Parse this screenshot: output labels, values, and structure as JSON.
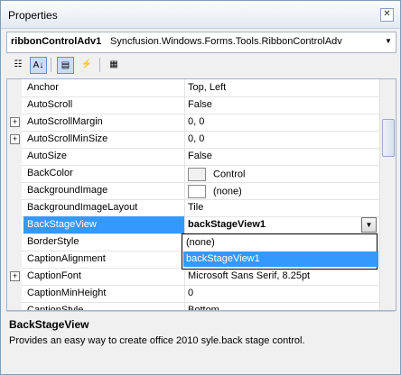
{
  "window": {
    "title": "Properties"
  },
  "object_selector": {
    "name": "ribbonControlAdv1",
    "type": "Syncfusion.Windows.Forms.Tools.RibbonControlAdv"
  },
  "toolbar": {
    "buttons": [
      {
        "icon": "categorized-icon",
        "glyph": "☷",
        "pressed": false
      },
      {
        "icon": "alphabetical-icon",
        "glyph": "A↓",
        "pressed": true
      },
      {
        "icon": "properties-icon",
        "glyph": "▤",
        "pressed": true
      },
      {
        "icon": "events-icon",
        "glyph": "⚡",
        "pressed": false
      },
      {
        "icon": "property-pages-icon",
        "glyph": "▦",
        "pressed": false
      }
    ]
  },
  "properties": [
    {
      "name": "Anchor",
      "value": "Top, Left",
      "expandable": false
    },
    {
      "name": "AutoScroll",
      "value": "False",
      "expandable": false
    },
    {
      "name": "AutoScrollMargin",
      "value": "0, 0",
      "expandable": true
    },
    {
      "name": "AutoScrollMinSize",
      "value": "0, 0",
      "expandable": true
    },
    {
      "name": "AutoSize",
      "value": "False",
      "expandable": false
    },
    {
      "name": "BackColor",
      "value": "Control",
      "expandable": false,
      "swatch": "gray"
    },
    {
      "name": "BackgroundImage",
      "value": "(none)",
      "expandable": false,
      "swatch": "white"
    },
    {
      "name": "BackgroundImageLayout",
      "value": "Tile",
      "expandable": false
    },
    {
      "name": "BackStageView",
      "value": "backStageView1",
      "expandable": false,
      "selected": true
    },
    {
      "name": "BorderStyle",
      "value": "",
      "expandable": false
    },
    {
      "name": "CaptionAlignment",
      "value": "",
      "expandable": false
    },
    {
      "name": "CaptionFont",
      "value": "Microsoft Sans Serif, 8.25pt",
      "expandable": true
    },
    {
      "name": "CaptionMinHeight",
      "value": "0",
      "expandable": false
    },
    {
      "name": "CaptionStyle",
      "value": "Bottom",
      "expandable": false
    }
  ],
  "dropdown": {
    "items": [
      "(none)",
      "backStageView1"
    ],
    "highlighted_index": 1
  },
  "help": {
    "title": "BackStageView",
    "description": "Provides an easy way to create office 2010 syle.back stage control."
  },
  "colors": {
    "selection": "#3399ff",
    "swatch_gray": "#f0f0f0"
  }
}
